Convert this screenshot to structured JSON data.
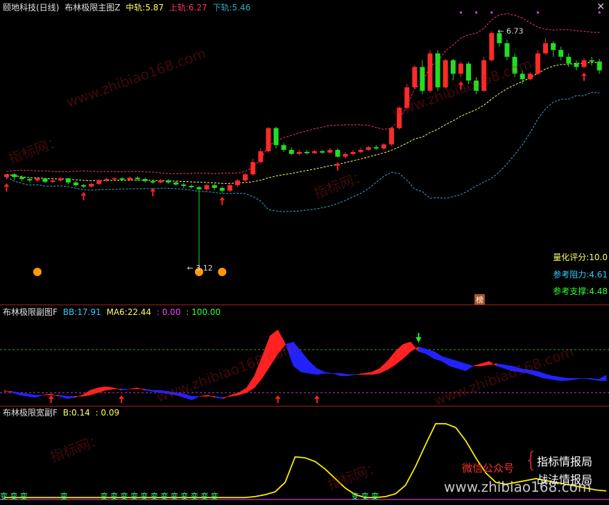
{
  "main_panel": {
    "title": "颐地科技(日线)",
    "indicator": "布林极限主图Z",
    "mid_label": "中轨:",
    "mid_value": "5.87",
    "upper_label": "上轨:",
    "upper_value": "6.27",
    "lower_label": "下轨:",
    "lower_value": "5.46",
    "peak_label": "6.73",
    "low_label": "3.12",
    "score_label": "量化评分:",
    "score_value": "10.0",
    "resist_label": "参考阻力:",
    "resist_value": "4.61",
    "support_label": "参考支撑:",
    "support_value": "4.48",
    "badge": "榜"
  },
  "sub_panel": {
    "indicator": "布林极限副图F",
    "bb_label": "BB:",
    "bb_value": "17.91",
    "ma6_label": "MA6:",
    "ma6_value": "22.44",
    "v1": ": 0.00",
    "v2": ": 100.00"
  },
  "width_panel": {
    "indicator": "布林极限宽副F",
    "b_label": "B:",
    "b_value": "0.14",
    "b2": ": 0.09",
    "bian_char": "变"
  },
  "overlay": {
    "wechat": "微信公众号",
    "brand1": "指标情报局",
    "brand2": "战法情报局",
    "watermark1": "指标网：",
    "watermark2": "www.zhibiao168.com"
  },
  "colors": {
    "up": "#ff2a2a",
    "down": "#22dd22",
    "mid": "#ffff66",
    "upper": "#ff3366",
    "lower": "#33aacc",
    "blue": "#2222ff"
  },
  "chart_data": [
    {
      "type": "candlestick",
      "series": [
        {
          "name": "K",
          "values": [
            [
              4.58,
              4.62,
              4.55,
              4.63
            ],
            [
              4.62,
              4.58,
              4.54,
              4.64
            ],
            [
              4.58,
              4.55,
              4.52,
              4.6
            ],
            [
              4.55,
              4.53,
              4.5,
              4.57
            ],
            [
              4.53,
              4.56,
              4.51,
              4.58
            ],
            [
              4.56,
              4.51,
              4.49,
              4.57
            ],
            [
              4.51,
              4.53,
              4.49,
              4.55
            ],
            [
              4.53,
              4.56,
              4.51,
              4.58
            ],
            [
              4.56,
              4.5,
              4.47,
              4.57
            ],
            [
              4.5,
              4.46,
              4.44,
              4.52
            ],
            [
              4.46,
              4.44,
              4.42,
              4.48
            ],
            [
              4.44,
              4.48,
              4.43,
              4.5
            ],
            [
              4.48,
              4.53,
              4.46,
              4.55
            ],
            [
              4.53,
              4.55,
              4.51,
              4.57
            ],
            [
              4.55,
              4.56,
              4.53,
              4.58
            ],
            [
              4.56,
              4.54,
              4.52,
              4.58
            ],
            [
              4.54,
              4.57,
              4.52,
              4.59
            ],
            [
              4.57,
              4.55,
              4.53,
              4.59
            ],
            [
              4.55,
              4.52,
              4.5,
              4.57
            ],
            [
              4.52,
              4.5,
              4.48,
              4.54
            ],
            [
              4.5,
              4.53,
              4.49,
              4.55
            ],
            [
              4.53,
              4.5,
              4.48,
              4.55
            ],
            [
              4.5,
              4.47,
              4.45,
              4.52
            ],
            [
              4.47,
              4.45,
              4.42,
              4.49
            ],
            [
              4.45,
              4.43,
              4.41,
              4.47
            ],
            [
              4.43,
              4.4,
              3.12,
              4.45
            ],
            [
              4.4,
              4.46,
              4.38,
              4.48
            ],
            [
              4.46,
              4.42,
              4.39,
              4.48
            ],
            [
              4.42,
              4.38,
              4.35,
              4.44
            ],
            [
              4.38,
              4.46,
              4.36,
              4.5
            ],
            [
              4.46,
              4.53,
              4.44,
              4.55
            ],
            [
              4.53,
              4.62,
              4.51,
              4.64
            ],
            [
              4.62,
              4.8,
              4.6,
              4.85
            ],
            [
              4.8,
              4.96,
              4.78,
              5.0
            ],
            [
              4.96,
              5.3,
              4.94,
              5.32
            ],
            [
              5.3,
              5.05,
              5.0,
              5.32
            ],
            [
              5.05,
              4.98,
              4.95,
              5.08
            ],
            [
              4.98,
              4.92,
              4.9,
              5.02
            ],
            [
              4.92,
              4.95,
              4.9,
              4.98
            ],
            [
              4.95,
              4.93,
              4.91,
              4.98
            ],
            [
              4.93,
              4.96,
              4.92,
              4.98
            ],
            [
              4.96,
              4.94,
              4.92,
              4.98
            ],
            [
              4.94,
              4.98,
              4.93,
              5.01
            ],
            [
              4.98,
              4.88,
              4.86,
              5.0
            ],
            [
              4.88,
              4.92,
              4.86,
              4.95
            ],
            [
              4.92,
              4.95,
              4.9,
              4.98
            ],
            [
              4.95,
              4.98,
              4.93,
              5.01
            ],
            [
              4.98,
              5.02,
              4.96,
              5.04
            ],
            [
              5.02,
              5.0,
              4.98,
              5.05
            ],
            [
              5.0,
              5.06,
              4.98,
              5.08
            ],
            [
              5.06,
              5.3,
              5.04,
              5.32
            ],
            [
              5.3,
              5.6,
              5.28,
              5.62
            ],
            [
              5.6,
              5.9,
              5.58,
              5.95
            ],
            [
              5.9,
              6.2,
              5.88,
              6.22
            ],
            [
              6.2,
              5.85,
              5.8,
              6.3
            ],
            [
              5.85,
              6.4,
              5.82,
              6.45
            ],
            [
              6.4,
              5.9,
              5.85,
              6.45
            ],
            [
              5.9,
              6.3,
              5.88,
              6.32
            ],
            [
              6.3,
              6.1,
              6.0,
              6.32
            ],
            [
              6.1,
              6.25,
              6.05,
              6.28
            ],
            [
              6.25,
              6.0,
              5.95,
              6.28
            ],
            [
              6.0,
              5.85,
              5.8,
              6.05
            ],
            [
              5.85,
              6.3,
              5.83,
              6.35
            ],
            [
              6.3,
              6.7,
              6.28,
              6.73
            ],
            [
              6.7,
              6.55,
              6.5,
              6.73
            ],
            [
              6.55,
              6.35,
              6.3,
              6.6
            ],
            [
              6.35,
              6.1,
              6.05,
              6.4
            ],
            [
              6.1,
              6.02,
              5.95,
              6.15
            ],
            [
              6.02,
              6.1,
              6.0,
              6.12
            ],
            [
              6.1,
              6.4,
              6.08,
              6.45
            ],
            [
              6.4,
              6.55,
              6.38,
              6.62
            ],
            [
              6.55,
              6.45,
              6.35,
              6.58
            ],
            [
              6.45,
              6.35,
              6.3,
              6.5
            ],
            [
              6.35,
              6.25,
              6.2,
              6.4
            ],
            [
              6.25,
              6.2,
              6.15,
              6.3
            ],
            [
              6.2,
              6.3,
              6.18,
              6.33
            ],
            [
              6.3,
              6.28,
              6.22,
              6.35
            ],
            [
              6.28,
              6.15,
              6.1,
              6.32
            ]
          ]
        }
      ],
      "lines": {
        "mid": "mid_value",
        "upper": "upper_value",
        "lower": "lower_value"
      }
    },
    {
      "type": "area",
      "series": [
        {
          "name": "BB",
          "values": [
            10,
            8,
            6,
            5,
            4,
            6,
            7,
            5,
            3,
            4,
            6,
            10,
            12,
            13,
            12,
            10,
            11,
            12,
            10,
            9,
            8,
            7,
            6,
            4,
            2,
            5,
            6,
            4,
            3,
            6,
            8,
            12,
            22,
            38,
            55,
            60,
            48,
            30,
            25,
            24,
            23,
            24,
            24,
            22,
            22,
            23,
            24,
            25,
            28,
            34,
            42,
            48,
            50,
            42,
            40,
            36,
            34,
            30,
            28,
            26,
            30,
            32,
            34,
            30,
            28,
            26,
            25,
            24,
            22,
            20,
            19,
            18,
            18,
            19,
            20,
            19,
            18,
            17.91
          ]
        },
        {
          "name": "MA6",
          "values": [
            9,
            9,
            8,
            7,
            6,
            6,
            6,
            6,
            5,
            5,
            5,
            6,
            8,
            10,
            11,
            11,
            11,
            11,
            11,
            10,
            10,
            9,
            8,
            7,
            5,
            5,
            5,
            5,
            4,
            5,
            6,
            8,
            12,
            20,
            30,
            40,
            48,
            50,
            42,
            34,
            28,
            25,
            24,
            24,
            23,
            23,
            23,
            23,
            24,
            27,
            31,
            36,
            42,
            46,
            44,
            42,
            38,
            36,
            34,
            32,
            30,
            30,
            31,
            32,
            31,
            30,
            28,
            27,
            26,
            24,
            22,
            21,
            20,
            20,
            20,
            20,
            19,
            22.44
          ]
        }
      ],
      "ylim": [
        0,
        100
      ]
    },
    {
      "type": "line",
      "series": [
        {
          "name": "B",
          "values": [
            0.02,
            0.02,
            0.02,
            0.02,
            0.02,
            0.02,
            0.02,
            0.02,
            0.02,
            0.02,
            0.02,
            0.02,
            0.02,
            0.02,
            0.02,
            0.02,
            0.02,
            0.02,
            0.02,
            0.02,
            0.02,
            0.02,
            0.02,
            0.02,
            0.02,
            0.03,
            0.05,
            0.08,
            0.18,
            0.45,
            0.44,
            0.4,
            0.32,
            0.22,
            0.12,
            0.05,
            0.02,
            0.02,
            0.03,
            0.06,
            0.15,
            0.35,
            0.58,
            0.8,
            0.8,
            0.76,
            0.62,
            0.44,
            0.28,
            0.18,
            0.16,
            0.18,
            0.2,
            0.22,
            0.2,
            0.18,
            0.16,
            0.14,
            0.12,
            0.1,
            0.09
          ]
        }
      ]
    }
  ]
}
